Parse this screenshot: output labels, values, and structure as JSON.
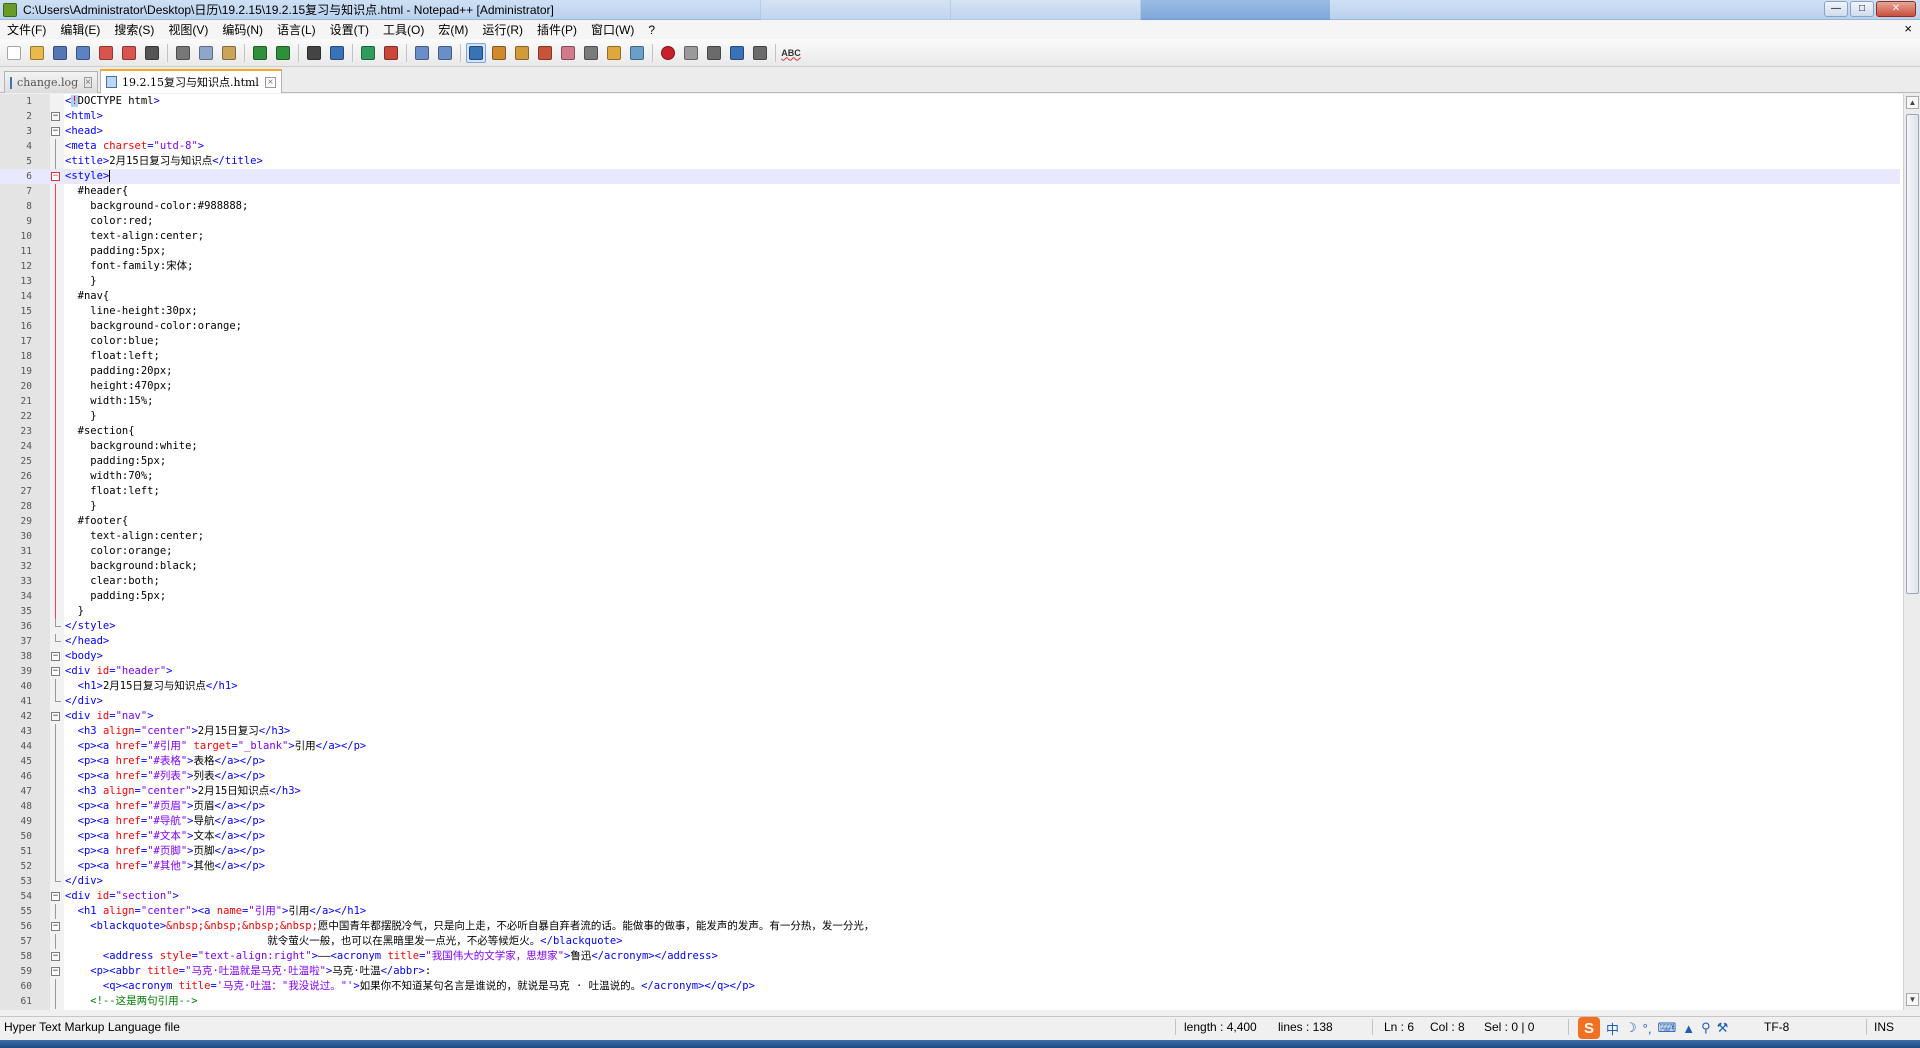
{
  "window": {
    "title": "C:\\Users\\Administrator\\Desktop\\日历\\19.2.15\\19.2.15复习与知识点.html - Notepad++ [Administrator]",
    "doc_close": "×"
  },
  "menu": [
    "文件(F)",
    "编辑(E)",
    "搜索(S)",
    "视图(V)",
    "编码(N)",
    "语言(L)",
    "设置(T)",
    "工具(O)",
    "宏(M)",
    "运行(R)",
    "插件(P)",
    "窗口(W)",
    "?"
  ],
  "toolbar": {
    "icons": [
      "new-file-icon",
      "open-file-icon",
      "save-icon",
      "save-all-icon",
      "close-icon",
      "close-all-icon",
      "print-icon",
      "cut-icon",
      "copy-icon",
      "paste-icon",
      "undo-icon",
      "redo-icon",
      "find-icon",
      "replace-icon",
      "zoom-in-icon",
      "zoom-out-icon",
      "sync-vertical-icon",
      "sync-horizontal-icon",
      "word-wrap-icon",
      "show-all-chars-icon",
      "indent-guide-icon",
      "user-language-icon",
      "doc-map-icon",
      "function-list-icon",
      "folder-workspace-icon",
      "monitor-icon",
      "record-macro-icon",
      "stop-record-icon",
      "play-macro-icon",
      "run-macro-multiple-icon",
      "save-macro-icon",
      "spell-check-icon"
    ],
    "spell_label": "ABC"
  },
  "tabs": [
    {
      "label": "change.log",
      "active": false
    },
    {
      "label": "19.2.15复习与知识点.html",
      "active": true
    }
  ],
  "code_lines": [
    [
      [
        "tag",
        "<"
      ],
      [
        "hlbr",
        "!"
      ],
      [
        "doct",
        "DOCTYPE html"
      ],
      [
        "tag",
        ">"
      ]
    ],
    [
      [
        "tag",
        "<html>"
      ]
    ],
    [
      [
        "tag",
        "<head>"
      ]
    ],
    [
      [
        "tag",
        "<meta "
      ],
      [
        "attr",
        "charset"
      ],
      [
        "tag",
        "="
      ],
      [
        "val",
        "\"utd-8\""
      ],
      [
        "tag",
        ">"
      ]
    ],
    [
      [
        "tag",
        "<title>"
      ],
      [
        "txt",
        "2月15日复习与知识点"
      ],
      [
        "tag",
        "</title>"
      ]
    ],
    [
      [
        "tag",
        "<style>"
      ]
    ],
    [
      [
        "txt",
        "  #header{"
      ]
    ],
    [
      [
        "txt",
        "    background-color:#988888;"
      ]
    ],
    [
      [
        "txt",
        "    color:red;"
      ]
    ],
    [
      [
        "txt",
        "    text-align:center;"
      ]
    ],
    [
      [
        "txt",
        "    padding:5px;"
      ]
    ],
    [
      [
        "txt",
        "    font-family:宋体;"
      ]
    ],
    [
      [
        "txt",
        "    }"
      ]
    ],
    [
      [
        "txt",
        "  #nav{"
      ]
    ],
    [
      [
        "txt",
        "    line-height:30px;"
      ]
    ],
    [
      [
        "txt",
        "    background-color:orange;"
      ]
    ],
    [
      [
        "txt",
        "    color:blue;"
      ]
    ],
    [
      [
        "txt",
        "    float:left;"
      ]
    ],
    [
      [
        "txt",
        "    padding:20px;"
      ]
    ],
    [
      [
        "txt",
        "    height:470px;"
      ]
    ],
    [
      [
        "txt",
        "    width:15%;"
      ]
    ],
    [
      [
        "txt",
        "    }"
      ]
    ],
    [
      [
        "txt",
        "  #section{"
      ]
    ],
    [
      [
        "txt",
        "    background:white;"
      ]
    ],
    [
      [
        "txt",
        "    padding:5px;"
      ]
    ],
    [
      [
        "txt",
        "    width:70%;"
      ]
    ],
    [
      [
        "txt",
        "    float:left;"
      ]
    ],
    [
      [
        "txt",
        "    }"
      ]
    ],
    [
      [
        "txt",
        "  #footer{"
      ]
    ],
    [
      [
        "txt",
        "    text-align:center;"
      ]
    ],
    [
      [
        "txt",
        "    color:orange;"
      ]
    ],
    [
      [
        "txt",
        "    background:black;"
      ]
    ],
    [
      [
        "txt",
        "    clear:both;"
      ]
    ],
    [
      [
        "txt",
        "    padding:5px;"
      ]
    ],
    [
      [
        "txt",
        "  }"
      ]
    ],
    [
      [
        "tag",
        "</style>"
      ]
    ],
    [
      [
        "tag",
        "</head>"
      ]
    ],
    [
      [
        "tag",
        "<body>"
      ]
    ],
    [
      [
        "tag",
        "<div "
      ],
      [
        "attr",
        "id"
      ],
      [
        "tag",
        "="
      ],
      [
        "val",
        "\"header\""
      ],
      [
        "tag",
        ">"
      ]
    ],
    [
      [
        "tag",
        "  <h1>"
      ],
      [
        "txt",
        "2月15日复习与知识点"
      ],
      [
        "tag",
        "</h1>"
      ]
    ],
    [
      [
        "tag",
        "</div>"
      ]
    ],
    [
      [
        "tag",
        "<div "
      ],
      [
        "attr",
        "id"
      ],
      [
        "tag",
        "="
      ],
      [
        "val",
        "\"nav\""
      ],
      [
        "tag",
        ">"
      ]
    ],
    [
      [
        "tag",
        "  <h3 "
      ],
      [
        "attr",
        "align"
      ],
      [
        "tag",
        "="
      ],
      [
        "val",
        "\"center\""
      ],
      [
        "tag",
        ">"
      ],
      [
        "txt",
        "2月15日复习"
      ],
      [
        "tag",
        "</h3>"
      ]
    ],
    [
      [
        "tag",
        "  <p><a "
      ],
      [
        "attr",
        "href"
      ],
      [
        "tag",
        "="
      ],
      [
        "val",
        "\"#引用\" "
      ],
      [
        "attr",
        "target"
      ],
      [
        "tag",
        "="
      ],
      [
        "val",
        "\"_blank\""
      ],
      [
        "tag",
        ">"
      ],
      [
        "txt",
        "引用"
      ],
      [
        "tag",
        "</a></p>"
      ]
    ],
    [
      [
        "tag",
        "  <p><a "
      ],
      [
        "attr",
        "href"
      ],
      [
        "tag",
        "="
      ],
      [
        "val",
        "\"#表格\""
      ],
      [
        "tag",
        ">"
      ],
      [
        "txt",
        "表格"
      ],
      [
        "tag",
        "</a></p>"
      ]
    ],
    [
      [
        "tag",
        "  <p><a "
      ],
      [
        "attr",
        "href"
      ],
      [
        "tag",
        "="
      ],
      [
        "val",
        "\"#列表\""
      ],
      [
        "tag",
        ">"
      ],
      [
        "txt",
        "列表"
      ],
      [
        "tag",
        "</a></p>"
      ]
    ],
    [
      [
        "tag",
        "  <h3 "
      ],
      [
        "attr",
        "align"
      ],
      [
        "tag",
        "="
      ],
      [
        "val",
        "\"center\""
      ],
      [
        "tag",
        ">"
      ],
      [
        "txt",
        "2月15日知识点"
      ],
      [
        "tag",
        "</h3>"
      ]
    ],
    [
      [
        "tag",
        "  <p><a "
      ],
      [
        "attr",
        "href"
      ],
      [
        "tag",
        "="
      ],
      [
        "val",
        "\"#页眉\""
      ],
      [
        "tag",
        ">"
      ],
      [
        "txt",
        "页眉"
      ],
      [
        "tag",
        "</a></p>"
      ]
    ],
    [
      [
        "tag",
        "  <p><a "
      ],
      [
        "attr",
        "href"
      ],
      [
        "tag",
        "="
      ],
      [
        "val",
        "\"#导航\""
      ],
      [
        "tag",
        ">"
      ],
      [
        "txt",
        "导航"
      ],
      [
        "tag",
        "</a></p>"
      ]
    ],
    [
      [
        "tag",
        "  <p><a "
      ],
      [
        "attr",
        "href"
      ],
      [
        "tag",
        "="
      ],
      [
        "val",
        "\"#文本\""
      ],
      [
        "tag",
        ">"
      ],
      [
        "txt",
        "文本"
      ],
      [
        "tag",
        "</a></p>"
      ]
    ],
    [
      [
        "tag",
        "  <p><a "
      ],
      [
        "attr",
        "href"
      ],
      [
        "tag",
        "="
      ],
      [
        "val",
        "\"#页脚\""
      ],
      [
        "tag",
        ">"
      ],
      [
        "txt",
        "页脚"
      ],
      [
        "tag",
        "</a></p>"
      ]
    ],
    [
      [
        "tag",
        "  <p><a "
      ],
      [
        "attr",
        "href"
      ],
      [
        "tag",
        "="
      ],
      [
        "val",
        "\"#其他\""
      ],
      [
        "tag",
        ">"
      ],
      [
        "txt",
        "其他"
      ],
      [
        "tag",
        "</a></p>"
      ]
    ],
    [
      [
        "tag",
        "</div>"
      ]
    ],
    [
      [
        "tag",
        "<div "
      ],
      [
        "attr",
        "id"
      ],
      [
        "tag",
        "="
      ],
      [
        "val",
        "\"section\""
      ],
      [
        "tag",
        ">"
      ]
    ],
    [
      [
        "tag",
        "  <h1 "
      ],
      [
        "attr",
        "align"
      ],
      [
        "tag",
        "="
      ],
      [
        "val",
        "\"center\""
      ],
      [
        "tag",
        "><a "
      ],
      [
        "attr",
        "name"
      ],
      [
        "tag",
        "="
      ],
      [
        "val",
        "\"引用\""
      ],
      [
        "tag",
        ">"
      ],
      [
        "txt",
        "引用"
      ],
      [
        "tag",
        "</a></h1>"
      ]
    ],
    [
      [
        "tag",
        "    <blackquote>"
      ],
      [
        "attr",
        "&nbsp;&nbsp;&nbsp;&nbsp;"
      ],
      [
        "txt",
        "愿中国青年都摆脱冷气，只是向上走，不必听自暴自弃者流的话。能做事的做事，能发声的发声。有一分热，发一分光，"
      ]
    ],
    [
      [
        "txt",
        "                                就令萤火一般，也可以在黑暗里发一点光，不必等候炬火。"
      ],
      [
        "tag",
        "</blackquote>"
      ]
    ],
    [
      [
        "tag",
        "      <address "
      ],
      [
        "attr",
        "style"
      ],
      [
        "tag",
        "="
      ],
      [
        "val",
        "\"text-align:right\""
      ],
      [
        "tag",
        ">"
      ],
      [
        "txt",
        "——"
      ],
      [
        "tag",
        "<acronym "
      ],
      [
        "attr",
        "title"
      ],
      [
        "tag",
        "="
      ],
      [
        "val",
        "\"我国伟大的文学家，思想家\""
      ],
      [
        "tag",
        ">"
      ],
      [
        "txt",
        "鲁迅"
      ],
      [
        "tag",
        "</acronym></address>"
      ]
    ],
    [
      [
        "tag",
        "    <p><abbr "
      ],
      [
        "attr",
        "title"
      ],
      [
        "tag",
        "="
      ],
      [
        "val",
        "\"马克·吐温就是马克·吐温啦\""
      ],
      [
        "tag",
        ">"
      ],
      [
        "txt",
        "马克·吐温"
      ],
      [
        "tag",
        "</abbr>"
      ],
      [
        "txt",
        ":"
      ]
    ],
    [
      [
        "tag",
        "      <q><acronym "
      ],
      [
        "attr",
        "title"
      ],
      [
        "tag",
        "="
      ],
      [
        "val",
        "'马克·吐温：\"我没说过。\"'"
      ],
      [
        "tag",
        ">"
      ],
      [
        "txt",
        "如果你不知道某句名言是谁说的，就说是马克 · 吐温说的。"
      ],
      [
        "tag",
        "</acronym></q></p>"
      ]
    ],
    [
      [
        "cmt",
        "    <!--这是两句引用-->"
      ]
    ]
  ],
  "status": {
    "file_type": "Hyper Text Markup Language file",
    "length": "length : 4,400",
    "lines": "lines : 138",
    "ln": "Ln : 6",
    "col": "Col : 8",
    "sel": "Sel : 0 | 0",
    "encoding": "TF-8",
    "mode": "INS",
    "ime_logo": "S",
    "ime_lang": "中"
  }
}
